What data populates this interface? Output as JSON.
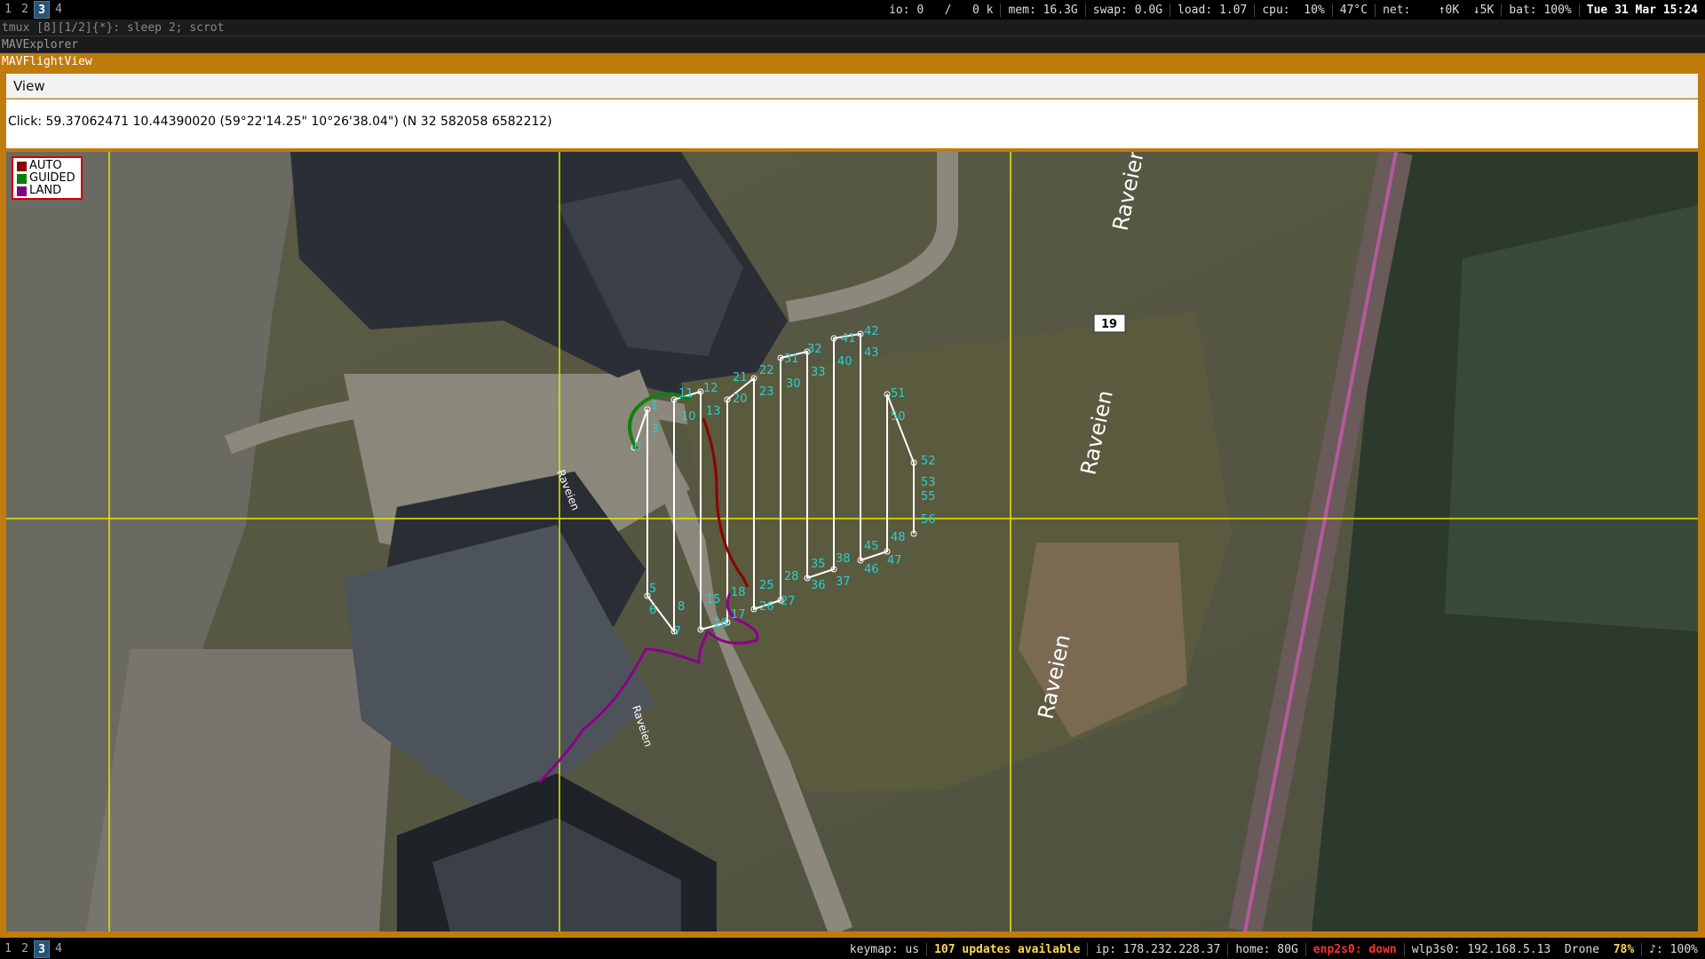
{
  "top_bar": {
    "workspaces": [
      "1",
      "2",
      "3",
      "4"
    ],
    "active_workspace": "3",
    "io": "io: 0   /   0 k",
    "mem": "mem: 16.3G",
    "swap": "swap: 0.0G",
    "load": "load: 1.07",
    "cpu": "cpu:  10%",
    "temp": "47°C",
    "net": "net:    ↑0K  ↓5K",
    "bat": "bat: 100%",
    "datetime": "Tue 31 Mar 15:24"
  },
  "windows": {
    "tmux_title": "tmux [8][1/2]{*}:  sleep 2; scrot",
    "explorer_title": "MAVExplorer",
    "flightview_title": "MAVFlightView"
  },
  "app": {
    "menu": [
      "View"
    ],
    "click_info": "Click: 59.37062471 10.44390020 (59°22'14.25\" 10°26'38.04\") (N 32 582058 6582212)"
  },
  "legend": [
    {
      "label": "AUTO",
      "color": "#8b0000"
    },
    {
      "label": "GUIDED",
      "color": "#008000"
    },
    {
      "label": "LAND",
      "color": "#800080"
    }
  ],
  "map": {
    "road_labels": [
      "Raveien",
      "Raveien",
      "Raveien",
      "Raveien",
      "Raveien"
    ],
    "road_shield": "19",
    "waypoint_labels": [
      "0",
      "1",
      "3",
      "5",
      "6",
      "7",
      "8",
      "10",
      "11",
      "12",
      "13",
      "15",
      "16",
      "17",
      "18",
      "20",
      "21",
      "22",
      "23",
      "25",
      "26",
      "27",
      "28",
      "30",
      "31",
      "32",
      "33",
      "35",
      "36",
      "37",
      "38",
      "40",
      "41",
      "42",
      "43",
      "45",
      "46",
      "47",
      "48",
      "51",
      "50",
      "52",
      "53",
      "55",
      "56"
    ],
    "grid_color": "#ffff00",
    "waypoint_label_color": "#2ad0d0"
  },
  "bottom_bar": {
    "workspaces": [
      "1",
      "2",
      "3",
      "4"
    ],
    "active_workspace": "3",
    "keymap": "keymap: us",
    "updates": "107 updates available",
    "ip": "ip: 178.232.228.37",
    "home": "home: 80G",
    "eth": "enp2s0: down",
    "wifi": "wlp3s0: 192.168.5.13",
    "ssid": "Drone",
    "wifi_pct": "78%",
    "volume": "♪: 100%"
  }
}
